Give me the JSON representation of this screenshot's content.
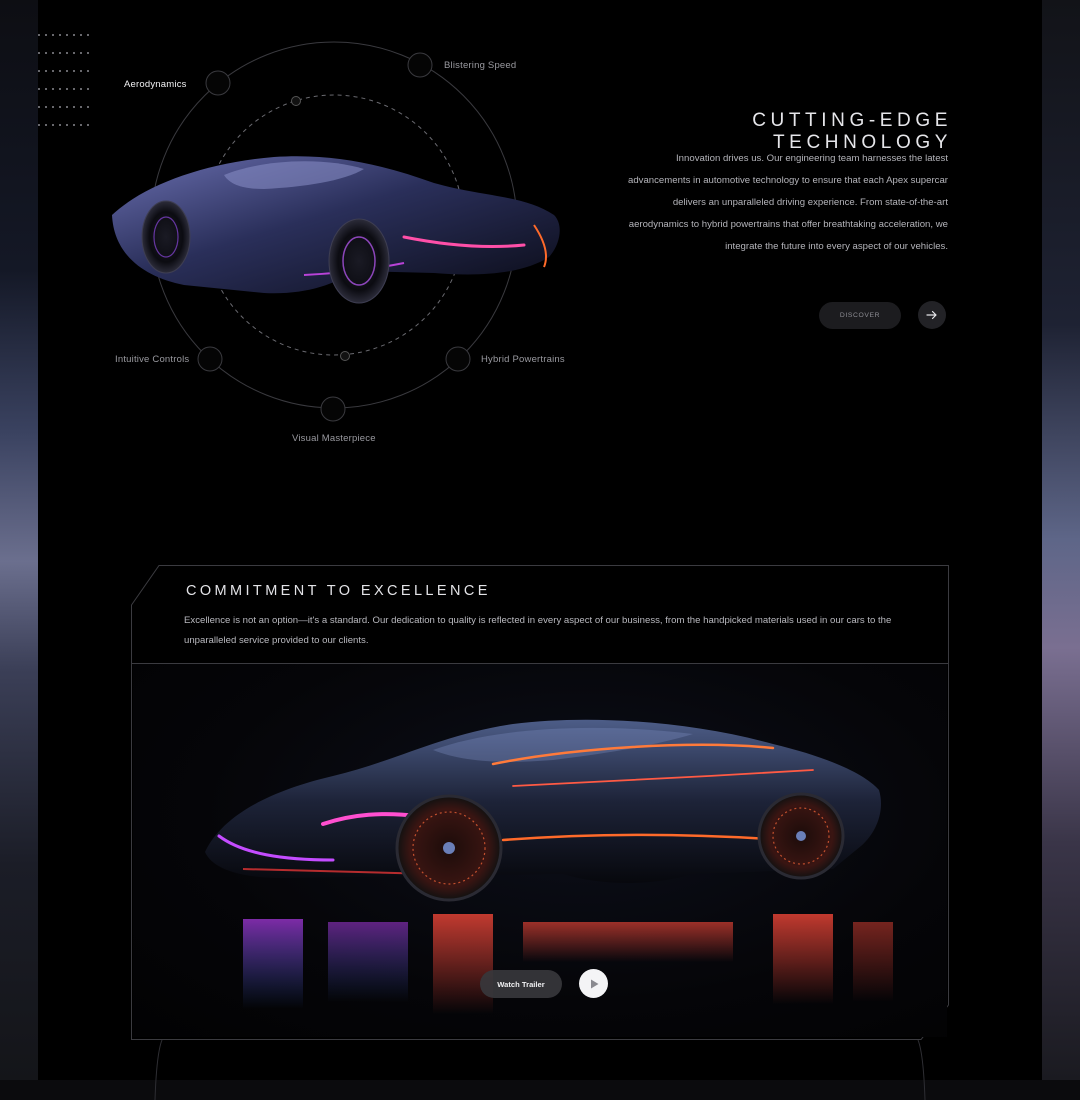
{
  "diagram": {
    "features": [
      {
        "label": "Aerodynamics",
        "active": true
      },
      {
        "label": "Blistering Speed",
        "active": false
      },
      {
        "label": "Intuitive Controls",
        "active": false
      },
      {
        "label": "Hybrid Powertrains",
        "active": false
      },
      {
        "label": "Visual Masterpiece",
        "active": false
      }
    ]
  },
  "technology": {
    "title": "CUTTING-EDGE TECHNOLOGY",
    "description": "Innovation drives us. Our engineering team harnesses the latest advancements in automotive technology to ensure that each Apex supercar delivers an unparalleled driving experience. From state-of-the-art aerodynamics to hybrid powertrains that offer breathtaking acceleration, we integrate the future into every aspect of our vehicles.",
    "discover_label": "DISCOVER"
  },
  "excellence": {
    "title": "COMMITMENT TO EXCELLENCE",
    "description": "Excellence is not an option—it's a standard. Our dedication to quality is reflected in every aspect of our business, from the handpicked materials used in our cars to the unparalleled service provided to our clients.",
    "trailer_label": "Watch Trailer"
  },
  "icons": {
    "discover_arrow": "arrow-right-icon",
    "play": "play-icon"
  },
  "colors": {
    "background": "#000000",
    "accent_glow_pink": "#ff3fa4",
    "accent_glow_orange": "#ff6a2a",
    "accent_glow_blue": "#3f7bff"
  }
}
